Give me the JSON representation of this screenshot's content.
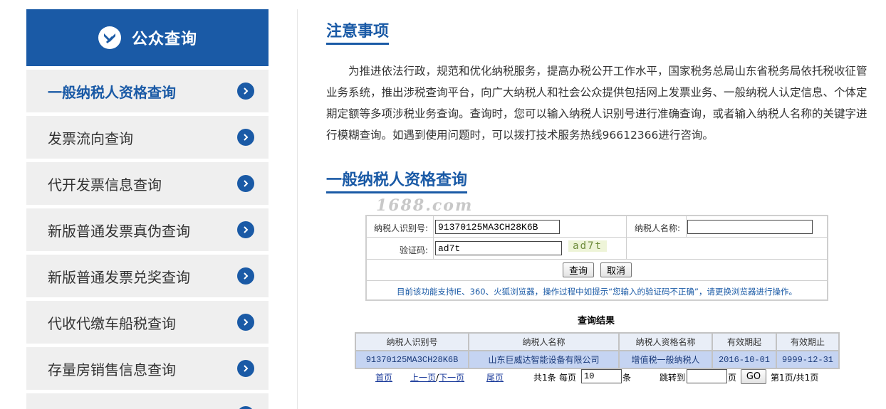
{
  "sidebar": {
    "header_title": "公众查询",
    "items": [
      {
        "label": "一般纳税人资格查询"
      },
      {
        "label": "发票流向查询"
      },
      {
        "label": "代开发票信息查询"
      },
      {
        "label": "新版普通发票真伪查询"
      },
      {
        "label": "新版普通发票兑奖查询"
      },
      {
        "label": "代收代缴车船税查询"
      },
      {
        "label": "存量房销售信息查询"
      }
    ]
  },
  "notice": {
    "title": "注意事项",
    "body": "为推进依法行政，规范和优化纳税服务，提高办税公开工作水平，国家税务总局山东省税务局依托税收征管业务系统，推出涉税查询平台，向广大纳税人和社会公众提供包括网上发票业务、一般纳税人认定信息、个体定期定额等多项涉税业务查询。查询时，您可以输入纳税人识别号进行准确查询，或者输入纳税人名称的关键字进行模糊查询。如遇到使用问题时，可以拨打技术服务热线96612366进行咨询。"
  },
  "query": {
    "title": "一般纳税人资格查询",
    "watermark": "1688.com",
    "taxpayer_id_label": "纳税人识别号:",
    "taxpayer_id_value": "91370125MA3CH28K6B",
    "taxpayer_name_label": "纳税人名称:",
    "taxpayer_name_value": "",
    "captcha_label": "验证码:",
    "captcha_value": "ad7t",
    "captcha_image_text": "ad7t",
    "search_button": "查询",
    "cancel_button": "取消",
    "tip": "目前该功能支持IE、360、火狐浏览器，操作过程中如提示“您输入的验证码不正确”，请更换浏览器进行操作。"
  },
  "results": {
    "title": "查询结果",
    "headers": [
      "纳税人识别号",
      "纳税人名称",
      "纳税人资格名称",
      "有效期起",
      "有效期止"
    ],
    "rows": [
      [
        "91370125MA3CH28K6B",
        "山东巨威达智能设备有限公司",
        "增值税一般纳税人",
        "2016-10-01",
        "9999-12-31"
      ]
    ]
  },
  "pager": {
    "first": "首页",
    "prev": "上一页",
    "sep": "/",
    "next": "下一页",
    "last": "尾页",
    "total": "共1条",
    "per_page_label": "每页",
    "per_page_value": "10",
    "per_page_unit": "条",
    "jump_label": "跳转到",
    "jump_value": "",
    "page_unit": "页",
    "go_button": "GO",
    "page_status": "第1页/共1页"
  },
  "colors": {
    "brand_blue": "#1a5aa6",
    "sidebar_item_bg": "#efefef",
    "result_row_bg": "#c5d4f2"
  }
}
